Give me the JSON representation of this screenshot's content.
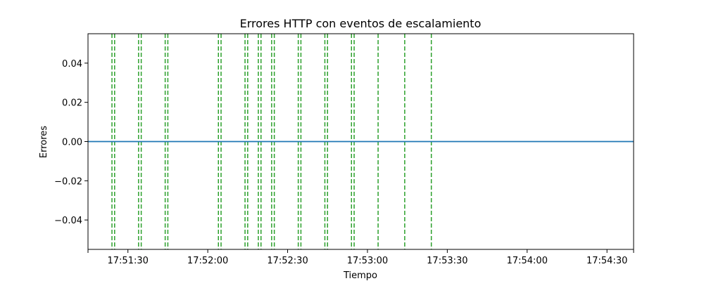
{
  "chart_data": {
    "type": "line",
    "title": "Errores HTTP con eventos de escalamiento",
    "xlabel": "Tiempo",
    "ylabel": "Errores",
    "xlim": [
      "17:51:15",
      "17:54:40"
    ],
    "ylim": [
      -0.055,
      0.055
    ],
    "x_ticks": [
      "17:51:30",
      "17:52:00",
      "17:52:30",
      "17:53:00",
      "17:53:30",
      "17:54:00",
      "17:54:30"
    ],
    "y_ticks": [
      "0.04",
      "0.02",
      "0.00",
      "−0.02",
      "−0.04"
    ],
    "y_tick_values": [
      0.04,
      0.02,
      0.0,
      -0.02,
      -0.04
    ],
    "grid": false,
    "series": [
      {
        "color": "#1f77b4",
        "x": [
          "17:51:15",
          "17:54:40"
        ],
        "y": [
          0,
          0
        ]
      }
    ],
    "event_lines": {
      "color": "#2ca02c",
      "style": "dashed",
      "x": [
        "17:51:24",
        "17:51:25",
        "17:51:34",
        "17:51:35",
        "17:51:44",
        "17:51:45",
        "17:52:04",
        "17:52:05",
        "17:52:14",
        "17:52:15",
        "17:52:19",
        "17:52:20",
        "17:52:24",
        "17:52:25",
        "17:52:34",
        "17:52:35",
        "17:52:44",
        "17:52:45",
        "17:52:54",
        "17:52:55",
        "17:53:04",
        "17:53:14",
        "17:53:24"
      ]
    }
  }
}
